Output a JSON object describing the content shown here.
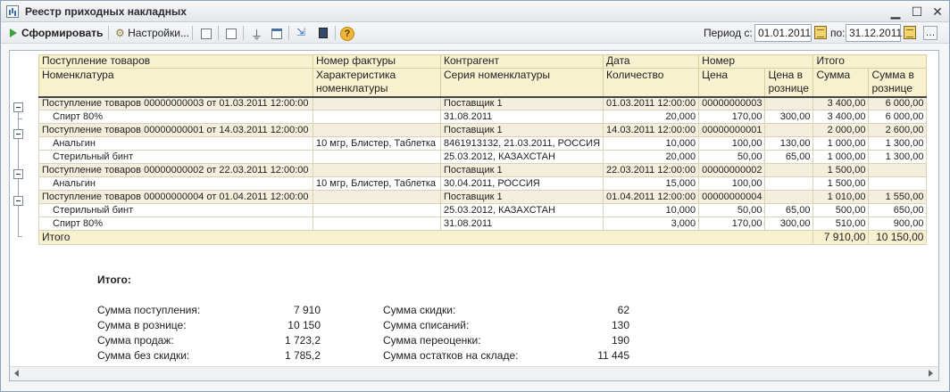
{
  "window": {
    "title": "Реестр приходных накладных"
  },
  "toolbar": {
    "generate_label": "Сформировать",
    "settings_label": "Настройки...",
    "period_from_label": "Период с:",
    "period_from_value": "01.01.2011",
    "period_to_label": "по:",
    "period_to_value": "31.12.2011"
  },
  "table": {
    "header1": [
      "Поступление товаров",
      "Номер фактуры",
      "Контрагент",
      "Дата",
      "Номер",
      "",
      "Итого",
      ""
    ],
    "header2": [
      "Номенклатура",
      "Характеристика номенклатуры",
      "Серия номенклатуры",
      "Количество",
      "Цена",
      "Цена в рознице",
      "Сумма",
      "Сумма в рознице"
    ],
    "rows": [
      {
        "type": "grp",
        "cells": [
          "Поступление товаров 00000000003 от 01.03.2011 12:00:00",
          "",
          "Поставщик 1",
          "01.03.2011 12:00:00",
          "00000000003",
          "",
          "3 400,00",
          "6 000,00"
        ]
      },
      {
        "type": "row",
        "cells": [
          "Спирт 80%",
          "",
          "31.08.2011",
          "20,000",
          "170,00",
          "300,00",
          "3 400,00",
          "6 000,00"
        ]
      },
      {
        "type": "grp",
        "cells": [
          "Поступление товаров 00000000001 от 14.03.2011 12:00:00",
          "",
          "Поставщик 1",
          "14.03.2011 12:00:00",
          "00000000001",
          "",
          "2 000,00",
          "2 600,00"
        ]
      },
      {
        "type": "row",
        "cells": [
          "Анальгин",
          "10 мгр, Блистер, Таблетка",
          "8461913132, 21.03.2011, РОССИЯ",
          "10,000",
          "100,00",
          "130,00",
          "1 000,00",
          "1 300,00"
        ]
      },
      {
        "type": "row",
        "cells": [
          "Стерильный бинт",
          "",
          "25.03.2012, КАЗАХСТАН",
          "20,000",
          "50,00",
          "65,00",
          "1 000,00",
          "1 300,00"
        ]
      },
      {
        "type": "grp",
        "cells": [
          "Поступление товаров 00000000002 от 22.03.2011 12:00:00",
          "",
          "Поставщик 1",
          "22.03.2011 12:00:00",
          "00000000002",
          "",
          "1 500,00",
          ""
        ]
      },
      {
        "type": "row",
        "cells": [
          "Анальгин",
          "10 мгр, Блистер, Таблетка",
          "30.04.2011, РОССИЯ",
          "15,000",
          "100,00",
          "",
          "1 500,00",
          ""
        ]
      },
      {
        "type": "grp",
        "cells": [
          "Поступление товаров 00000000004 от 01.04.2011 12:00:00",
          "",
          "Поставщик 1",
          "01.04.2011 12:00:00",
          "00000000004",
          "",
          "1 010,00",
          "1 550,00"
        ]
      },
      {
        "type": "row",
        "cells": [
          "Стерильный бинт",
          "",
          "25.03.2012, КАЗАХСТАН",
          "10,000",
          "50,00",
          "65,00",
          "500,00",
          "650,00"
        ]
      },
      {
        "type": "row",
        "cells": [
          "Спирт 80%",
          "",
          "31.08.2011",
          "3,000",
          "170,00",
          "300,00",
          "510,00",
          "900,00"
        ]
      }
    ],
    "total": {
      "label": "Итого",
      "sum": "7 910,00",
      "sum_retail": "10 150,00"
    }
  },
  "summary": {
    "title": "Итого:",
    "left": [
      {
        "label": "Сумма поступления:",
        "value": "7 910"
      },
      {
        "label": "Сумма в рознице:",
        "value": "10 150"
      },
      {
        "label": "Сумма продаж:",
        "value": "1 723,2"
      },
      {
        "label": "Сумма без скидки:",
        "value": "1 785,2"
      }
    ],
    "right": [
      {
        "label": "Сумма скидки:",
        "value": "62"
      },
      {
        "label": "Сумма списаний:",
        "value": "130"
      },
      {
        "label": "Сумма переоценки:",
        "value": "190"
      },
      {
        "label": "Сумма остатков на складе:",
        "value": "11 445"
      }
    ]
  }
}
